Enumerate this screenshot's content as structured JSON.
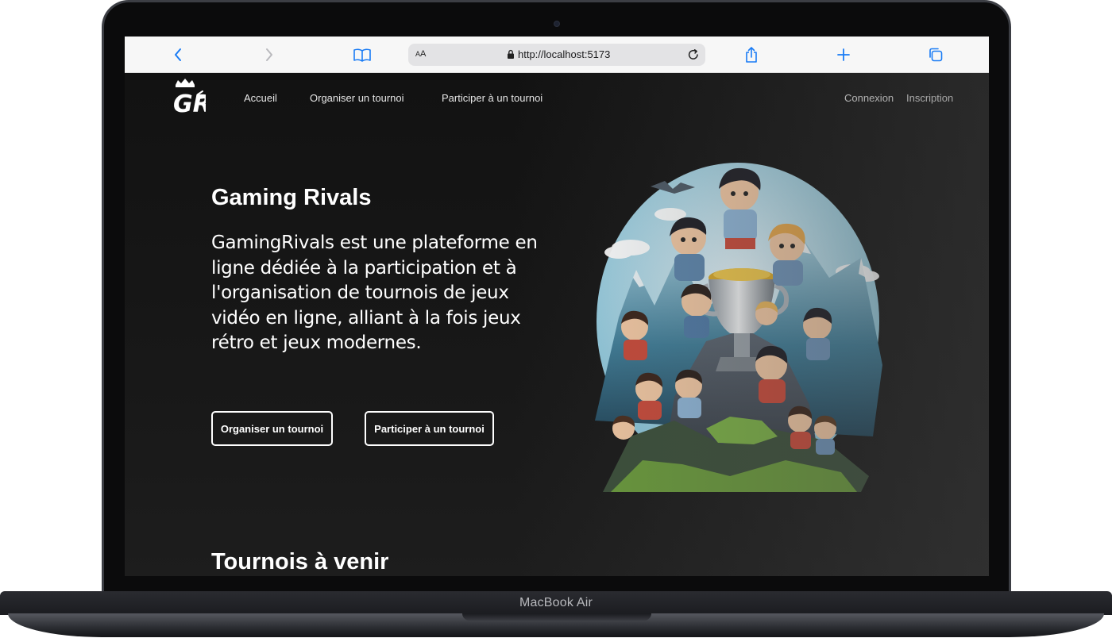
{
  "device": {
    "label": "MacBook Air"
  },
  "browser": {
    "reader_label_small": "A",
    "reader_label_big": "A",
    "url": "http://localhost:5173",
    "icons": [
      "back-icon",
      "forward-icon",
      "bookmarks-icon",
      "lock-icon",
      "reload-icon",
      "share-icon",
      "new-tab-icon",
      "tabs-icon"
    ]
  },
  "nav": {
    "brand_letters": "GR",
    "links": [
      "Accueil",
      "Organiser un tournoi",
      "Participer à un tournoi"
    ],
    "auth": [
      "Connexion",
      "Inscription"
    ]
  },
  "hero": {
    "title": "Gaming Rivals",
    "description": "GamingRivals est une plateforme en ligne dédiée à la participation et à l'organisation de tournois de jeux vidéo en ligne, alliant à la fois jeux rétro et jeux modernes.",
    "buttons": [
      "Organiser un tournoi",
      "Participer à un tournoi"
    ]
  },
  "section": {
    "title": "Tournois à venir"
  },
  "colors": {
    "page_bg": "#141414",
    "text": "#ffffff",
    "link_blue": "#1a7cf5"
  }
}
